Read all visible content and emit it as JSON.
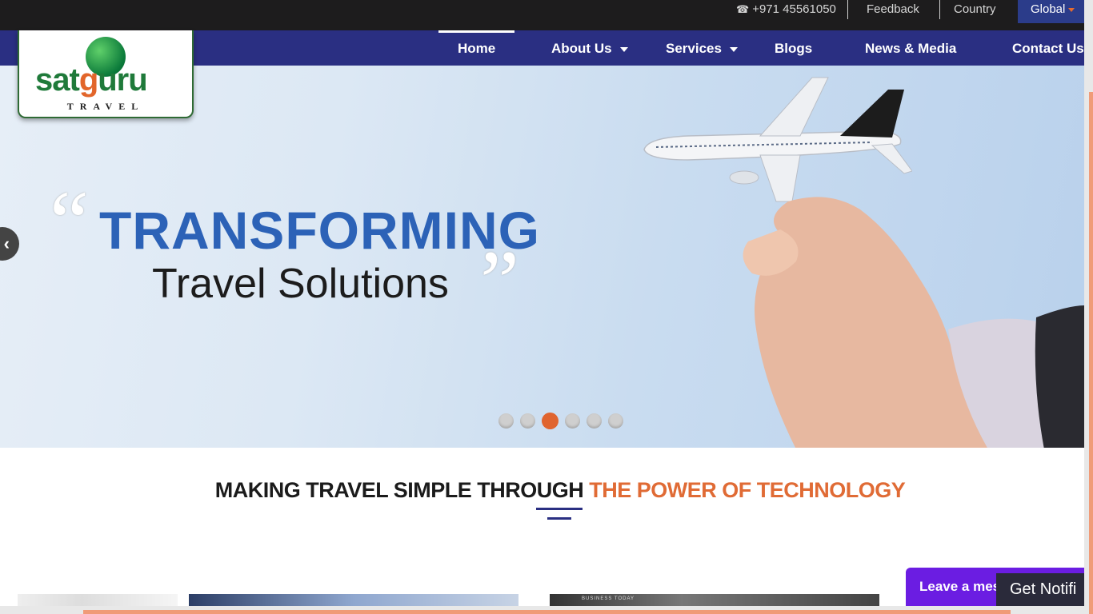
{
  "topbar": {
    "phone_icon": "phone-icon",
    "phone": "+971 45561050",
    "feedback": "Feedback",
    "country": "Country",
    "global": "Global"
  },
  "nav": {
    "items": [
      {
        "label": "Home",
        "active": true
      },
      {
        "label": "About Us",
        "dropdown": true
      },
      {
        "label": "Services",
        "dropdown": true
      },
      {
        "label": "Blogs"
      },
      {
        "label": "News & Media"
      },
      {
        "label": "Contact Us"
      }
    ]
  },
  "logo": {
    "text_pre": "sat",
    "text_g": "g",
    "text_post": "uru",
    "sub": "TRAVEL"
  },
  "hero": {
    "title": "TRANSFORMING",
    "subtitle": "Travel Solutions",
    "prev_icon": "chevron-left-icon",
    "slides": 6,
    "active_slide": 3
  },
  "section": {
    "title_main": "MAKING TRAVEL SIMPLE THROUGH ",
    "title_accent": "THE POWER OF TECHNOLOGY"
  },
  "thumbs": {
    "third_label": "BUSINESS TODAY"
  },
  "chat": {
    "leave_message": "Leave a mes",
    "notify": "Get Notifi"
  },
  "colors": {
    "nav_bg": "#2a2f82",
    "accent": "#e0642f",
    "topbar_bg": "#1d1c1d",
    "brand_green": "#1f7a3a"
  }
}
